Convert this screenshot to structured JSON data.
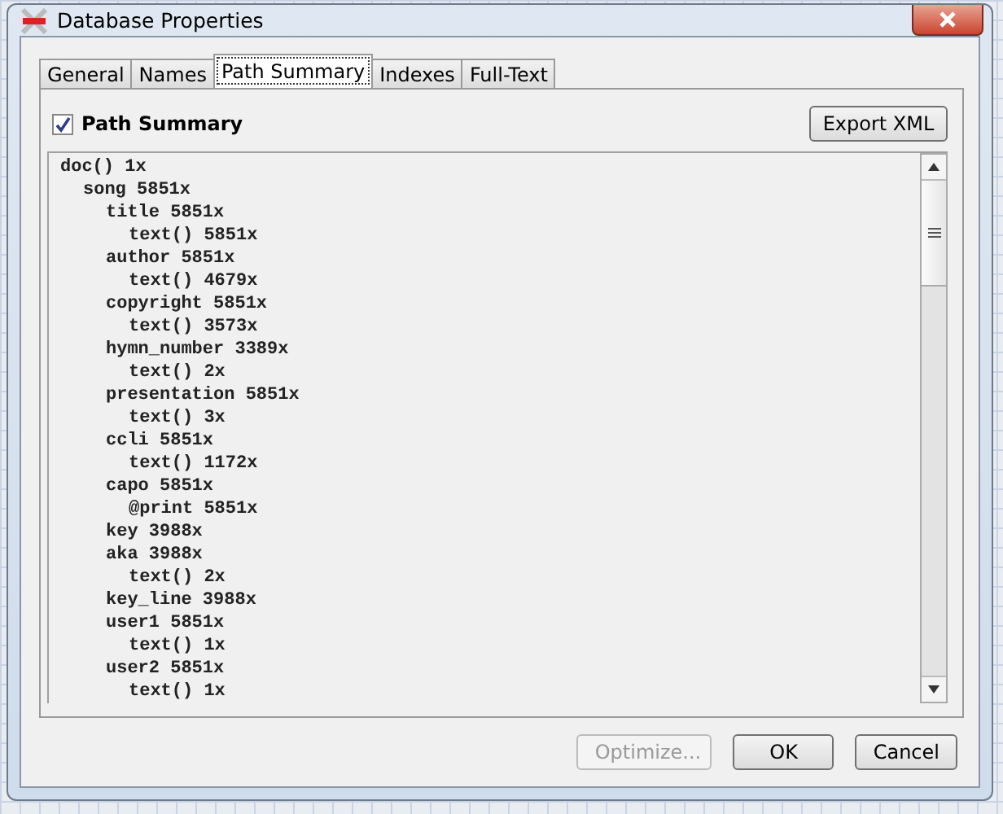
{
  "window": {
    "title": "Database Properties"
  },
  "tabs": [
    {
      "label": "General",
      "selected": false
    },
    {
      "label": "Names",
      "selected": false
    },
    {
      "label": "Path Summary",
      "selected": true
    },
    {
      "label": "Indexes",
      "selected": false
    },
    {
      "label": "Full-Text",
      "selected": false
    }
  ],
  "path_summary": {
    "label": "Path Summary",
    "checked": true
  },
  "export_button": "Export XML",
  "tree": [
    {
      "text": "doc() 1x",
      "children": [
        {
          "text": "song 5851x",
          "children": [
            {
              "text": "title 5851x",
              "children": [
                {
                  "text": "text() 5851x"
                }
              ]
            },
            {
              "text": "author 5851x",
              "children": [
                {
                  "text": "text() 4679x"
                }
              ]
            },
            {
              "text": "copyright 5851x",
              "children": [
                {
                  "text": "text() 3573x"
                }
              ]
            },
            {
              "text": "hymn_number 3389x",
              "children": [
                {
                  "text": "text() 2x"
                }
              ]
            },
            {
              "text": "presentation 5851x",
              "children": [
                {
                  "text": "text() 3x"
                }
              ]
            },
            {
              "text": "ccli 5851x",
              "children": [
                {
                  "text": "text() 1172x"
                }
              ]
            },
            {
              "text": "capo 5851x",
              "children": [
                {
                  "text": "@print 5851x"
                }
              ]
            },
            {
              "text": "key 3988x"
            },
            {
              "text": "aka 3988x",
              "children": [
                {
                  "text": "text() 2x"
                }
              ]
            },
            {
              "text": "key_line 3988x"
            },
            {
              "text": "user1 5851x",
              "children": [
                {
                  "text": "text() 1x"
                }
              ]
            },
            {
              "text": "user2 5851x",
              "children": [
                {
                  "text": "text() 1x"
                }
              ]
            }
          ]
        }
      ]
    }
  ],
  "buttons": [
    {
      "label": "Optimize...",
      "disabled": true
    },
    {
      "label": "OK",
      "disabled": false
    },
    {
      "label": "Cancel",
      "disabled": false
    }
  ]
}
